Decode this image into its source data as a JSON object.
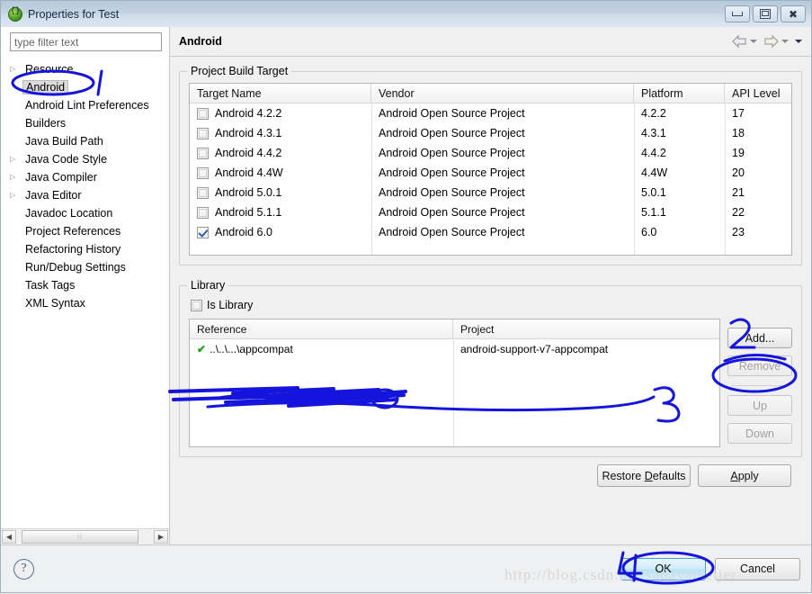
{
  "window": {
    "title": "Properties for Test",
    "icon": "eclipse-properties-icon",
    "minimize_label": "Minimize",
    "restore_label": "Restore",
    "close_label": "Close"
  },
  "sidebar": {
    "filter": {
      "placeholder": "type filter text",
      "value": ""
    },
    "items": [
      {
        "label": "Resource",
        "expandable": true,
        "selected": false
      },
      {
        "label": "Android",
        "expandable": false,
        "selected": true
      },
      {
        "label": "Android Lint Preferences",
        "expandable": false,
        "selected": false
      },
      {
        "label": "Builders",
        "expandable": false,
        "selected": false
      },
      {
        "label": "Java Build Path",
        "expandable": false,
        "selected": false
      },
      {
        "label": "Java Code Style",
        "expandable": true,
        "selected": false
      },
      {
        "label": "Java Compiler",
        "expandable": true,
        "selected": false
      },
      {
        "label": "Java Editor",
        "expandable": true,
        "selected": false
      },
      {
        "label": "Javadoc Location",
        "expandable": false,
        "selected": false
      },
      {
        "label": "Project References",
        "expandable": false,
        "selected": false
      },
      {
        "label": "Refactoring History",
        "expandable": false,
        "selected": false
      },
      {
        "label": "Run/Debug Settings",
        "expandable": false,
        "selected": false
      },
      {
        "label": "Task Tags",
        "expandable": false,
        "selected": false
      },
      {
        "label": "XML Syntax",
        "expandable": false,
        "selected": false
      }
    ]
  },
  "content": {
    "title": "Android",
    "nav": {
      "back": "back-arrow",
      "back_menu": "back-dropdown",
      "forward": "forward-arrow",
      "forward_menu": "forward-dropdown",
      "view_menu": "view-menu"
    }
  },
  "build_target": {
    "group_title": "Project Build Target",
    "columns": [
      "Target Name",
      "Vendor",
      "Platform",
      "API Level"
    ],
    "rows": [
      {
        "checked": false,
        "name": "Android 4.2.2",
        "vendor": "Android Open Source Project",
        "platform": "4.2.2",
        "api": "17"
      },
      {
        "checked": false,
        "name": "Android 4.3.1",
        "vendor": "Android Open Source Project",
        "platform": "4.3.1",
        "api": "18"
      },
      {
        "checked": false,
        "name": "Android 4.4.2",
        "vendor": "Android Open Source Project",
        "platform": "4.4.2",
        "api": "19"
      },
      {
        "checked": false,
        "name": "Android 4.4W",
        "vendor": "Android Open Source Project",
        "platform": "4.4W",
        "api": "20"
      },
      {
        "checked": false,
        "name": "Android 5.0.1",
        "vendor": "Android Open Source Project",
        "platform": "5.0.1",
        "api": "21"
      },
      {
        "checked": false,
        "name": "Android 5.1.1",
        "vendor": "Android Open Source Project",
        "platform": "5.1.1",
        "api": "22"
      },
      {
        "checked": true,
        "name": "Android 6.0",
        "vendor": "Android Open Source Project",
        "platform": "6.0",
        "api": "23"
      }
    ]
  },
  "library": {
    "group_title": "Library",
    "is_library_label": "Is Library",
    "is_library_checked": false,
    "columns": [
      "Reference",
      "Project"
    ],
    "rows": [
      {
        "status": "✔",
        "reference": "..\\..\\...\\appcompat",
        "project": "android-support-v7-appcompat"
      }
    ],
    "buttons": [
      {
        "label": "Add...",
        "enabled": true
      },
      {
        "label": "Remove",
        "enabled": false
      },
      {
        "label": "Up",
        "enabled": false
      },
      {
        "label": "Down",
        "enabled": false
      }
    ]
  },
  "footer": {
    "restore_defaults": "Restore Defaults",
    "restore_defaults_mnemonic": "D",
    "apply": "Apply",
    "apply_mnemonic": "A",
    "ok": "OK",
    "cancel": "Cancel",
    "help": "?"
  },
  "watermark": {
    "text": "http://blog.csdn.net/sadayameijer"
  },
  "annotations": {
    "color": "#1414dc",
    "marks": [
      {
        "id": "1",
        "label": "1",
        "target": "sidebar-item-android"
      },
      {
        "id": "2",
        "label": "2",
        "target": "library-add-button"
      },
      {
        "id": "3",
        "label": "3",
        "target": "library-table-row"
      },
      {
        "id": "4",
        "label": "4",
        "target": "ok-button"
      }
    ]
  }
}
